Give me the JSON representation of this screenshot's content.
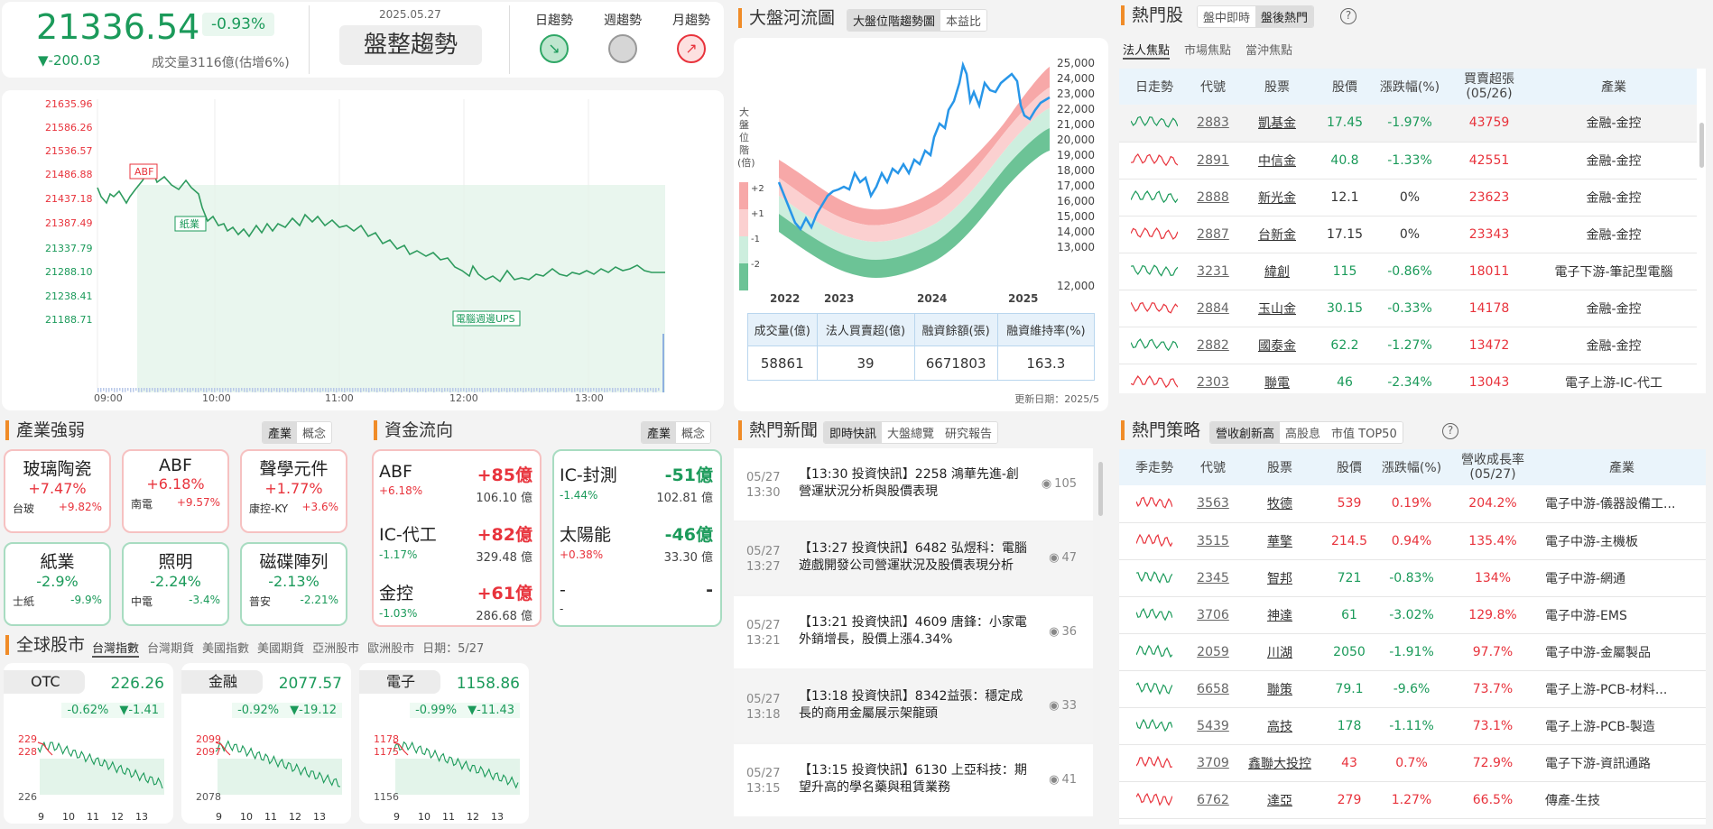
{
  "index": {
    "value": "21336.54",
    "pct": "-0.93%",
    "change": "▼-200.03",
    "volume": "成交量3116億(估增6%)",
    "date": "2025.05.27",
    "trend_label": "盤整趨勢",
    "trend_tabs": [
      "日趨勢",
      "週趨勢",
      "月趨勢"
    ]
  },
  "intraday": {
    "yticks": [
      "21635.96",
      "21586.26",
      "21536.57",
      "21486.88",
      "21437.18",
      "21387.49",
      "21337.79",
      "21288.10",
      "21238.41",
      "21188.71"
    ],
    "xticks": [
      "09:00",
      "10:00",
      "11:00",
      "12:00",
      "13:00"
    ],
    "tags": [
      "ABF",
      "紙業",
      "電腦週邊UPS"
    ]
  },
  "river": {
    "title": "大盤河流圖",
    "tabs": [
      "大盤位階趨勢圖",
      "本益比"
    ],
    "ylabel": "大盤位階(倍)",
    "bands": [
      "+2",
      "+1",
      "-1",
      "-2"
    ],
    "yticks": [
      "25,000",
      "24,000",
      "23,000",
      "22,000",
      "21,000",
      "20,000",
      "19,000",
      "18,000",
      "17,000",
      "16,000",
      "15,000",
      "14,000",
      "13,000",
      "12,000"
    ],
    "xticks": [
      "2022",
      "2023",
      "2024",
      "2025"
    ],
    "table_headers": [
      "成交量(億)",
      "法人買賣超(億)",
      "融資餘額(張)",
      "融資維持率(%)"
    ],
    "table_values": [
      "58861",
      "39",
      "6671803",
      "163.3"
    ],
    "update": "更新日期：2025/5"
  },
  "hot": {
    "title": "熱門股",
    "tabs": [
      "盤中即時",
      "盤後熱門"
    ],
    "subtabs": [
      "法人焦點",
      "市場焦點",
      "當沖焦點"
    ],
    "headers": [
      "日走勢",
      "代號",
      "股票",
      "股價",
      "漲跌幅(%)",
      "買賣超張 (05/26)",
      "產業"
    ],
    "rows": [
      [
        "2883",
        "凱基金",
        "17.45",
        "-1.97%",
        "43759",
        "金融-金控"
      ],
      [
        "2891",
        "中信金",
        "40.8",
        "-1.33%",
        "42551",
        "金融-金控"
      ],
      [
        "2888",
        "新光金",
        "12.1",
        "0%",
        "23623",
        "金融-金控"
      ],
      [
        "2887",
        "台新金",
        "17.15",
        "0%",
        "23343",
        "金融-金控"
      ],
      [
        "3231",
        "緯創",
        "115",
        "-0.86%",
        "18011",
        "電子下游-筆記型電腦"
      ],
      [
        "2884",
        "玉山金",
        "30.15",
        "-0.33%",
        "14178",
        "金融-金控"
      ],
      [
        "2882",
        "國泰金",
        "62.2",
        "-1.27%",
        "13472",
        "金融-金控"
      ],
      [
        "2303",
        "聯電",
        "46",
        "-2.34%",
        "13043",
        "電子上游-IC-代工"
      ]
    ]
  },
  "industry": {
    "title": "產業強弱",
    "tabs": [
      "產業",
      "概念"
    ],
    "items": [
      {
        "name": "玻璃陶瓷",
        "pct": "+7.47%",
        "stock": "台玻",
        "spct": "+9.82%"
      },
      {
        "name": "ABF",
        "pct": "+6.18%",
        "stock": "南電",
        "spct": "+9.57%"
      },
      {
        "name": "聲學元件",
        "pct": "+1.77%",
        "stock": "康控-KY",
        "spct": "+3.6%"
      },
      {
        "name": "紙業",
        "pct": "-2.9%",
        "stock": "士紙",
        "spct": "-9.9%"
      },
      {
        "name": "照明",
        "pct": "-2.24%",
        "stock": "中電",
        "spct": "-3.4%"
      },
      {
        "name": "磁碟陣列",
        "pct": "-2.13%",
        "stock": "普安",
        "spct": "-2.21%"
      }
    ]
  },
  "flow": {
    "title": "資金流向",
    "tabs": [
      "產業",
      "概念"
    ],
    "items": [
      {
        "name": "ABF",
        "pct": "+6.18%",
        "amt": "+85億",
        "tot": "106.10 億"
      },
      {
        "name": "IC-代工",
        "pct": "-1.17%",
        "amt": "+82億",
        "tot": "329.48 億"
      },
      {
        "name": "金控",
        "pct": "-1.03%",
        "amt": "+61億",
        "tot": "286.68 億"
      },
      {
        "name": "IC-封測",
        "pct": "-1.44%",
        "amt": "-51億",
        "tot": "102.81 億"
      },
      {
        "name": "太陽能",
        "pct": "+0.38%",
        "amt": "-46億",
        "tot": "33.30 億"
      },
      {
        "name": "-",
        "pct": "-",
        "amt": "-",
        "tot": ""
      }
    ]
  },
  "global": {
    "title": "全球股市",
    "tabs": [
      "台灣指數",
      "台灣期貨",
      "美國指數",
      "美國期貨",
      "亞洲股市",
      "歐洲股市"
    ],
    "date": "日期：5/27",
    "cards": [
      {
        "name": "OTC",
        "val": "226.26",
        "pct": "-0.62%",
        "chg": "▼-1.41",
        "ticks": [
          "229",
          "228",
          "226"
        ]
      },
      {
        "name": "金融",
        "val": "2077.57",
        "pct": "-0.92%",
        "chg": "▼-19.12",
        "ticks": [
          "2099",
          "2097",
          "2078"
        ]
      },
      {
        "name": "電子",
        "val": "1158.86",
        "pct": "-0.99%",
        "chg": "▼-11.43",
        "ticks": [
          "1178",
          "1175",
          "1156"
        ]
      }
    ],
    "xticks": [
      "9",
      "10",
      "11",
      "12",
      "13"
    ]
  },
  "news": {
    "title": "熱門新聞",
    "tabs": [
      "即時快訊",
      "大盤總覽",
      "研究報告"
    ],
    "items": [
      {
        "d": "05/27",
        "t": "13:30",
        "h": "【13:30 投資快訊】2258 鴻華先進-創 營運狀況分析與股價表現",
        "v": "105"
      },
      {
        "d": "05/27",
        "t": "13:27",
        "h": "【13:27 投資快訊】6482 弘煜科：電腦遊戲開發公司營運狀況及股價表現分析",
        "v": "47"
      },
      {
        "d": "05/27",
        "t": "13:21",
        "h": "【13:21 投資快訊】4609 唐鋒：小家電外銷增長，股價上漲4.34%",
        "v": "36"
      },
      {
        "d": "05/27",
        "t": "13:18",
        "h": "【13:18 投資快訊】8342益張：穩定成長的商用金屬展示架龍頭",
        "v": "33"
      },
      {
        "d": "05/27",
        "t": "13:15",
        "h": "【13:15 投資快訊】6130 上亞科技：期望升高的學名藥與租賃業務",
        "v": "41"
      }
    ]
  },
  "strategy": {
    "title": "熱門策略",
    "tabs": [
      "營收創新高",
      "高股息",
      "市值 TOP50"
    ],
    "headers": [
      "季走勢",
      "代號",
      "股票",
      "股價",
      "漲跌幅(%)",
      "營收成長率 (05/27)",
      "產業"
    ],
    "rows": [
      [
        "3563",
        "牧德",
        "539",
        "0.19%",
        "204.2%",
        "電子中游-儀器設備工..."
      ],
      [
        "3515",
        "華擎",
        "214.5",
        "0.94%",
        "135.4%",
        "電子中游-主機板"
      ],
      [
        "2345",
        "智邦",
        "721",
        "-0.83%",
        "134%",
        "電子中游-網通"
      ],
      [
        "3706",
        "神達",
        "61",
        "-3.02%",
        "129.8%",
        "電子中游-EMS"
      ],
      [
        "2059",
        "川湖",
        "2050",
        "-1.91%",
        "97.7%",
        "電子中游-金屬製品"
      ],
      [
        "6658",
        "聯策",
        "79.1",
        "-9.6%",
        "73.7%",
        "電子上游-PCB-材料..."
      ],
      [
        "5439",
        "高技",
        "178",
        "-1.11%",
        "73.1%",
        "電子上游-PCB-製造"
      ],
      [
        "3709",
        "鑫聯大投控",
        "43",
        "0.7%",
        "72.9%",
        "電子下游-資訊通路"
      ],
      [
        "6762",
        "達亞",
        "279",
        "1.27%",
        "66.5%",
        "傳產-生技"
      ]
    ]
  }
}
